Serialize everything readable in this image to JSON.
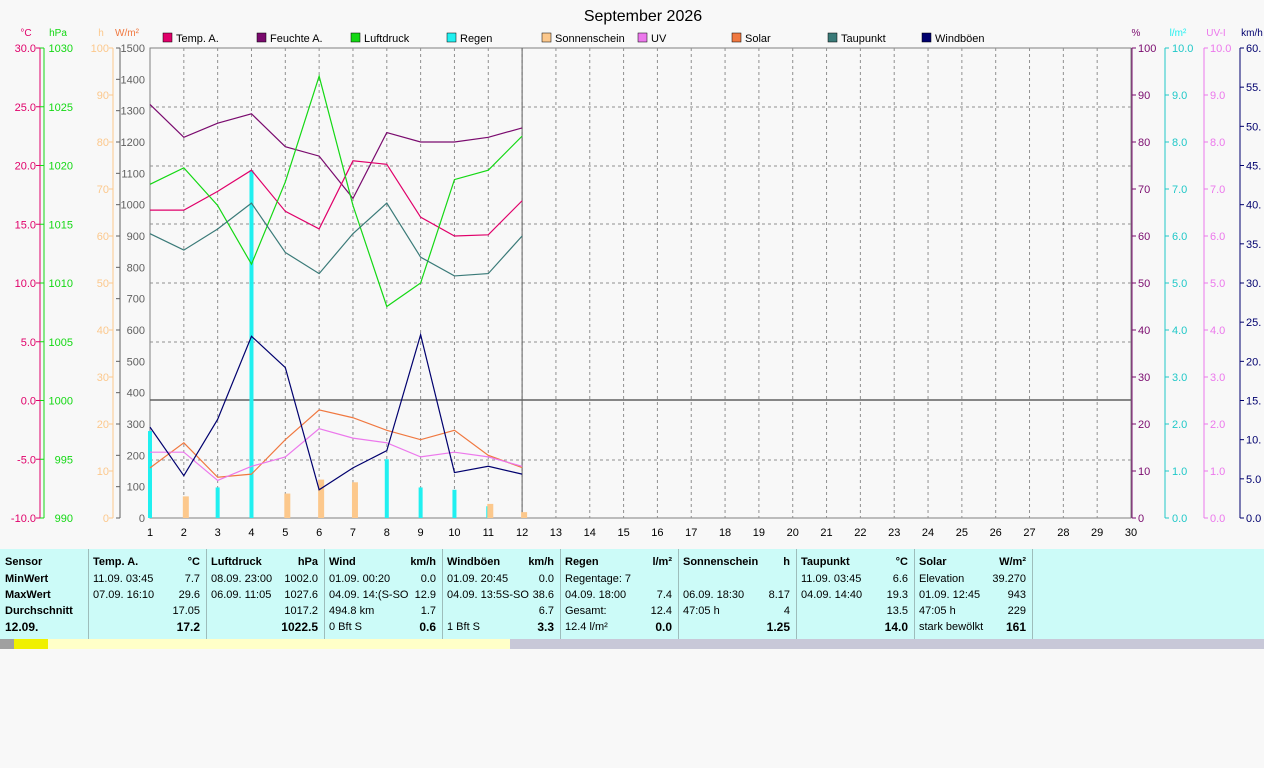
{
  "title": "September 2026",
  "legend": [
    {
      "label": "Temp. A.",
      "color": "#e0006a"
    },
    {
      "label": "Feuchte A.",
      "color": "#7a0a6e"
    },
    {
      "label": "Luftdruck",
      "color": "#14d814"
    },
    {
      "label": "Regen",
      "color": "#20f0f0"
    },
    {
      "label": "Sonnenschein",
      "color": "#fcc88c"
    },
    {
      "label": "UV",
      "color": "#ec78ec"
    },
    {
      "label": "Solar",
      "color": "#f07840"
    },
    {
      "label": "Taupunkt",
      "color": "#3a7a78"
    },
    {
      "label": "Windböen",
      "color": "#00006e"
    }
  ],
  "axis_units": {
    "temp": "°C",
    "pressure": "hPa",
    "sun": "h",
    "solar": "W/m²",
    "humidity": "%",
    "rain": "l/m²",
    "uv": "UV-I",
    "wind": "km/h"
  },
  "axis_ticks": {
    "temp": [
      "30.0",
      "25.0",
      "20.0",
      "15.0",
      "10.0",
      "5.0",
      "0.0",
      "-5.0",
      "-10.0"
    ],
    "pressure": [
      "1030",
      "1025",
      "1020",
      "1015",
      "1010",
      "1005",
      "1000",
      "995",
      "990"
    ],
    "sun": [
      "100",
      "90",
      "80",
      "70",
      "60",
      "50",
      "40",
      "30",
      "20",
      "10",
      "0"
    ],
    "solar": [
      "1500",
      "1400",
      "1300",
      "1200",
      "1100",
      "1000",
      "900",
      "800",
      "700",
      "600",
      "500",
      "400",
      "300",
      "200",
      "100",
      "0"
    ],
    "humidity": [
      "100",
      "90",
      "80",
      "70",
      "60",
      "50",
      "40",
      "30",
      "20",
      "10",
      "0"
    ],
    "rain": [
      "10.0",
      "9.0",
      "8.0",
      "7.0",
      "6.0",
      "5.0",
      "4.0",
      "3.0",
      "2.0",
      "1.0",
      "0.0"
    ],
    "uv": [
      "10.0",
      "9.0",
      "8.0",
      "7.0",
      "6.0",
      "5.0",
      "4.0",
      "3.0",
      "2.0",
      "1.0",
      "0.0"
    ],
    "wind": [
      "60.",
      "55.",
      "50.",
      "45.",
      "40.",
      "35.",
      "30.",
      "25.",
      "20.",
      "15.",
      "10.",
      "5.0",
      "0.0"
    ],
    "days": [
      "1",
      "2",
      "3",
      "4",
      "5",
      "6",
      "7",
      "8",
      "9",
      "10",
      "11",
      "12",
      "13",
      "14",
      "15",
      "16",
      "17",
      "18",
      "19",
      "20",
      "21",
      "22",
      "23",
      "24",
      "25",
      "26",
      "27",
      "28",
      "29",
      "30"
    ]
  },
  "chart_data": {
    "type": "line",
    "title": "September 2026",
    "x": [
      1,
      2,
      3,
      4,
      5,
      6,
      7,
      8,
      9,
      10,
      11,
      12
    ],
    "xlim": [
      1,
      30
    ],
    "series": [
      {
        "name": "Feuchte A.",
        "unit": "%",
        "color": "#7a0a6e",
        "values": [
          88,
          81,
          84,
          86,
          79,
          77,
          68,
          82,
          80,
          80,
          81,
          83
        ]
      },
      {
        "name": "Temp. A.",
        "unit": "°C",
        "color": "#e0006a",
        "values": [
          16.2,
          16.2,
          17.8,
          19.6,
          16.1,
          14.6,
          20.4,
          20.1,
          15.6,
          14.0,
          14.1,
          17.0
        ]
      },
      {
        "name": "Luftdruck",
        "unit": "hPa",
        "color": "#14d814",
        "values": [
          1018.4,
          1019.8,
          1016.6,
          1011.6,
          1018.6,
          1027.6,
          1016.6,
          1008.0,
          1010.0,
          1018.8,
          1019.6,
          1022.5
        ]
      },
      {
        "name": "Taupunkt",
        "unit": "°C",
        "color": "#3a7a78",
        "values": [
          14.2,
          12.8,
          14.6,
          16.8,
          12.6,
          10.8,
          14.2,
          16.8,
          12.2,
          10.6,
          10.8,
          14.0
        ]
      },
      {
        "name": "Solar",
        "unit": "W/m²",
        "color": "#f07840",
        "values": [
          160,
          240,
          130,
          140,
          250,
          345,
          320,
          280,
          250,
          280,
          200,
          161
        ]
      },
      {
        "name": "UV",
        "unit": "UV-I",
        "color": "#ec78ec",
        "values": [
          1.4,
          1.4,
          0.8,
          1.1,
          1.3,
          1.9,
          1.7,
          1.6,
          1.3,
          1.4,
          1.3,
          1.1
        ]
      },
      {
        "name": "Windböen",
        "unit": "km/h",
        "color": "#00006e",
        "values": [
          11.6,
          5.4,
          12.6,
          23.2,
          19.2,
          3.6,
          6.4,
          8.6,
          23.4,
          5.8,
          6.6,
          5.6
        ]
      },
      {
        "name": "Regen",
        "unit": "l/m²",
        "color": "#20f0f0",
        "values": [
          1.85,
          0.0,
          0.65,
          7.4,
          0.0,
          0.0,
          0.0,
          1.25,
          0.65,
          0.6,
          0.25,
          0.0
        ]
      },
      {
        "name": "Sonnenschein",
        "unit": "h",
        "color": "#fcc88c",
        "values": [
          0.0,
          4.6,
          0.0,
          0.0,
          5.2,
          8.17,
          7.6,
          0.0,
          0.0,
          0.0,
          3.0,
          1.25
        ]
      }
    ],
    "ylim": {
      "temp": [
        -10,
        30
      ],
      "pressure": [
        990,
        1030
      ],
      "sun": [
        0,
        100
      ],
      "solar": [
        0,
        1500
      ],
      "humidity": [
        0,
        100
      ],
      "rain": [
        0,
        10
      ],
      "uv": [
        0,
        10
      ],
      "wind": [
        0,
        60
      ]
    },
    "grid": true
  },
  "table": {
    "sensor": {
      "header": "Sensor",
      "rows": [
        "MinWert",
        "MaxWert",
        "Durchschnitt",
        "12.09."
      ]
    },
    "sections": [
      {
        "header": "Temp. A.",
        "unit": "°C",
        "rows": [
          [
            "11.09.  03:45",
            "7.7"
          ],
          [
            "07.09.  16:10",
            "29.6"
          ],
          [
            "",
            "17.05"
          ],
          [
            "",
            "17.2"
          ]
        ]
      },
      {
        "header": "Luftdruck",
        "unit": "hPa",
        "rows": [
          [
            "08.09.  23:00",
            "1002.0"
          ],
          [
            "06.09.  11:05",
            "1027.6"
          ],
          [
            "",
            "1017.2"
          ],
          [
            "",
            "1022.5"
          ]
        ]
      },
      {
        "header": "Wind",
        "unit": "km/h",
        "rows": [
          [
            "01.09.  00:20",
            "0.0"
          ],
          [
            "04.09.  14:(S-SO",
            "12.9"
          ],
          [
            "494.8 km",
            "1.7"
          ],
          [
            "0 Bft S",
            "0.6"
          ]
        ]
      },
      {
        "header": "Windböen",
        "unit": "km/h",
        "rows": [
          [
            "01.09.  20:45",
            "0.0"
          ],
          [
            "04.09.  13:5S-SO",
            "38.6"
          ],
          [
            "",
            "6.7"
          ],
          [
            "1 Bft S",
            "3.3"
          ]
        ]
      },
      {
        "header": "Regen",
        "unit": "l/m²",
        "rows": [
          [
            "Regentage: 7",
            ""
          ],
          [
            "04.09.  18:00",
            "7.4"
          ],
          [
            "Gesamt:",
            "12.4"
          ],
          [
            "12.4 l/m²",
            "0.0"
          ]
        ]
      },
      {
        "header": "Sonnenschein",
        "unit": "h",
        "rows": [
          [
            "",
            ""
          ],
          [
            "06.09.  18:30",
            "8.17"
          ],
          [
            "47:05 h",
            "4"
          ],
          [
            "",
            "1.25"
          ]
        ]
      },
      {
        "header": "Taupunkt",
        "unit": "°C",
        "rows": [
          [
            "11.09.  03:45",
            "6.6"
          ],
          [
            "04.09.  14:40",
            "19.3"
          ],
          [
            "",
            "13.5"
          ],
          [
            "",
            "14.0"
          ]
        ]
      },
      {
        "header": "Solar",
        "unit": "W/m²",
        "rows": [
          [
            "Elevation",
            "39.270"
          ],
          [
            "01.09.  12:45",
            "943"
          ],
          [
            "47:05 h",
            "229"
          ],
          [
            "stark bewölkt",
            "161"
          ]
        ]
      }
    ]
  }
}
